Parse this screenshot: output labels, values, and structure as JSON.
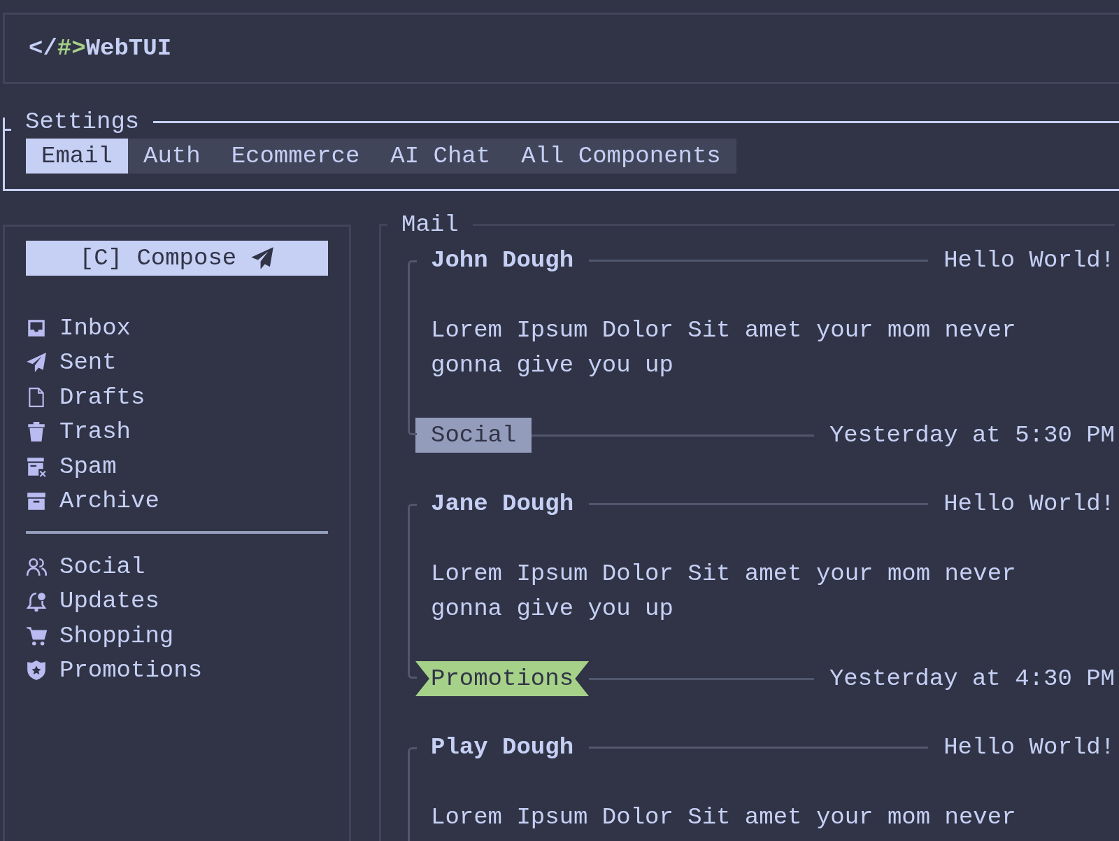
{
  "header": {
    "logo": {
      "prefix": "</",
      "mark": "#>",
      "name": "WebTUI"
    }
  },
  "settings": {
    "title": "Settings",
    "tabs": [
      {
        "label": "Email",
        "selected": true
      },
      {
        "label": "Auth",
        "selected": false
      },
      {
        "label": "Ecommerce",
        "selected": false
      },
      {
        "label": "AI Chat",
        "selected": false
      },
      {
        "label": "All Components",
        "selected": false
      }
    ]
  },
  "sidebar": {
    "compose": "[C] Compose",
    "folders": [
      {
        "label": "Inbox"
      },
      {
        "label": "Sent"
      },
      {
        "label": "Drafts"
      },
      {
        "label": "Trash"
      },
      {
        "label": "Spam"
      },
      {
        "label": "Archive"
      }
    ],
    "categories": [
      {
        "label": "Social"
      },
      {
        "label": "Updates"
      },
      {
        "label": "Shopping"
      },
      {
        "label": "Promotions"
      }
    ]
  },
  "mail": {
    "title": "Mail",
    "messages": [
      {
        "sender": "John Dough",
        "subject": "Hello World!",
        "body": "Lorem Ipsum Dolor Sit amet your mom never gonna give you up",
        "tag": {
          "label": "Social",
          "kind": "plain",
          "color": "#949cbb"
        },
        "time": "Yesterday at 5:30 PM"
      },
      {
        "sender": "Jane Dough",
        "subject": "Hello World!",
        "body": "Lorem Ipsum Dolor Sit amet your mom never gonna give you up",
        "tag": {
          "label": "Promotions",
          "kind": "ribbon",
          "color": "#a6d189"
        },
        "time": "Yesterday at 4:30 PM"
      },
      {
        "sender": "Play Dough",
        "subject": "Hello World!",
        "body": "Lorem Ipsum Dolor Sit amet your mom never"
      }
    ]
  }
}
